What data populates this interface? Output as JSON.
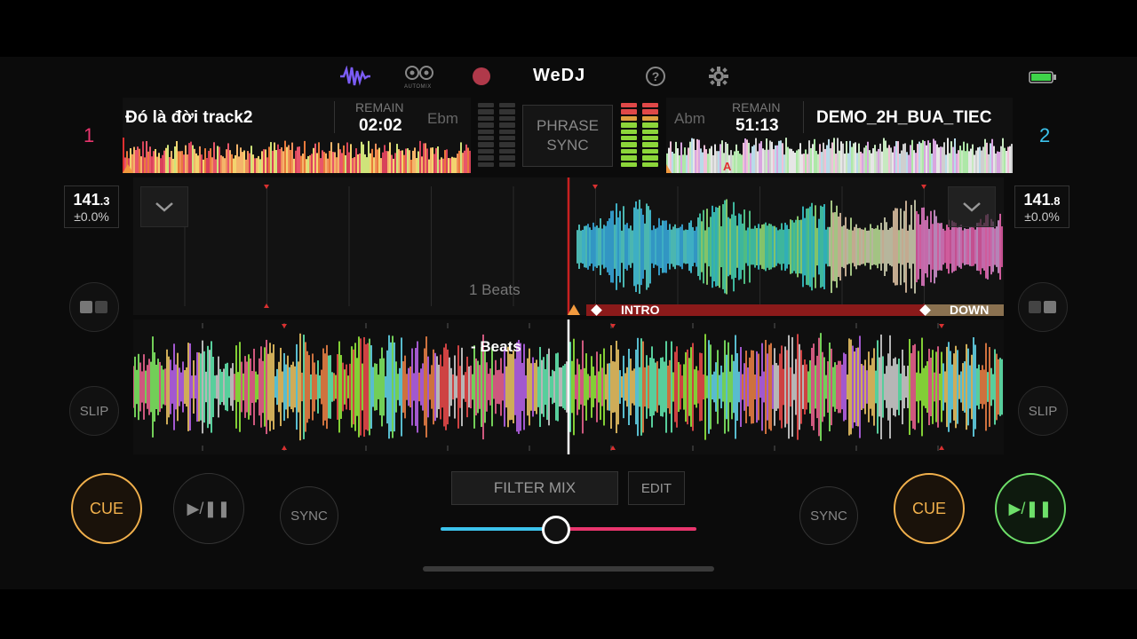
{
  "header": {
    "brand": "WeDJ",
    "automix_label": "AUTOMIX",
    "colors": {
      "wave_icon": "#7b5cf5",
      "record": "#b0394a",
      "battery": "#3fd44a"
    },
    "icons": [
      "waveform-icon",
      "automix-icon",
      "record-icon",
      "help-icon",
      "settings-icon",
      "battery-icon"
    ]
  },
  "deck1": {
    "number": "1",
    "title": "Đó là đời track2",
    "remain_label": "REMAIN",
    "remain": "02:02",
    "key": "Ebm",
    "bpm_int": "141",
    "bpm_dec": ".3",
    "pitch": "±0.0%",
    "number_color": "#e8356d",
    "cue": "CUE",
    "play": "▶/❚❚",
    "sync": "SYNC",
    "slip": "SLIP",
    "beats": "1 Beats"
  },
  "deck2": {
    "number": "2",
    "title": "DEMO_2H_BUA_TIEC",
    "remain_label": "REMAIN",
    "remain": "51:13",
    "key": "Abm",
    "bpm_int": "141",
    "bpm_dec": ".8",
    "pitch": "±0.0%",
    "number_color": "#3cc3ec",
    "cue": "CUE",
    "play": "▶/❚❚",
    "sync": "SYNC",
    "slip": "SLIP",
    "beats": "- Beats",
    "hot_cue_marker": "A"
  },
  "center": {
    "phrase_sync_line1": "PHRASE",
    "phrase_sync_line2": "SYNC",
    "filter_mix": "FILTER MIX",
    "edit": "EDIT",
    "crossfader_position": 0.45
  },
  "phrases": {
    "intro": "INTRO",
    "down": "DOWN"
  }
}
